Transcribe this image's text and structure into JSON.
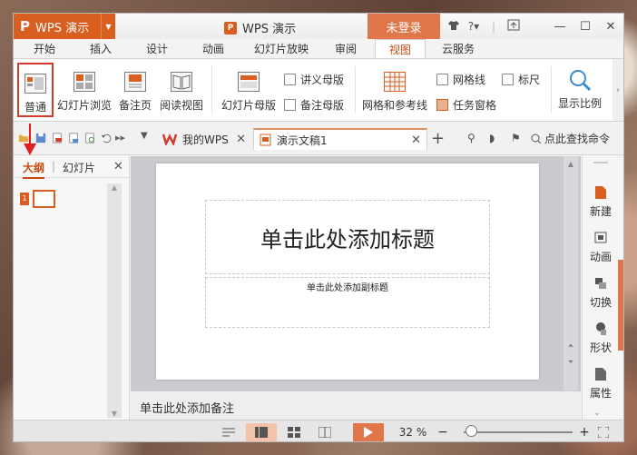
{
  "app": {
    "menu_label": "WPS 演示",
    "menu_logo": "P",
    "title": "WPS 演示",
    "login": "未登录"
  },
  "window_controls": [
    "minimize",
    "maximize",
    "close"
  ],
  "menu_tabs": [
    {
      "label": "开始"
    },
    {
      "label": "插入"
    },
    {
      "label": "设计"
    },
    {
      "label": "动画"
    },
    {
      "label": "幻灯片放映"
    },
    {
      "label": "审阅"
    },
    {
      "label": "视图",
      "active": true
    },
    {
      "label": "云服务"
    }
  ],
  "ribbon": {
    "normal": "普通",
    "slide_sorter": "幻灯片浏览",
    "notes_page": "备注页",
    "reading_view": "阅读视图",
    "slide_master": "幻灯片母版",
    "handout_master": "讲义母版",
    "notes_master": "备注母版",
    "grid_guides": "网格和参考线",
    "gridlines": "网格线",
    "ruler": "标尺",
    "task_pane": "任务窗格",
    "zoom": "显示比例"
  },
  "doc_tabs": {
    "mywps": "我的WPS",
    "presentation": "演示文稿1",
    "search": "点此查找命令"
  },
  "left_panel": {
    "tab_outline": "大纲",
    "tab_slides": "幻灯片",
    "slide_number": "1"
  },
  "slide": {
    "title_placeholder": "单击此处添加标题",
    "subtitle_placeholder": "单击此处添加副标题"
  },
  "notes_placeholder": "单击此处添加备注",
  "task_pane": [
    {
      "label": "新建",
      "icon": "new-slide-icon"
    },
    {
      "label": "动画",
      "icon": "animation-icon"
    },
    {
      "label": "切换",
      "icon": "transition-icon"
    },
    {
      "label": "形状",
      "icon": "shape-icon"
    },
    {
      "label": "属性",
      "icon": "properties-icon"
    }
  ],
  "status": {
    "zoom": "32 %"
  },
  "colors": {
    "accent": "#d95f21",
    "login_bg": "#e0764a",
    "highlight": "#d43a2e"
  }
}
